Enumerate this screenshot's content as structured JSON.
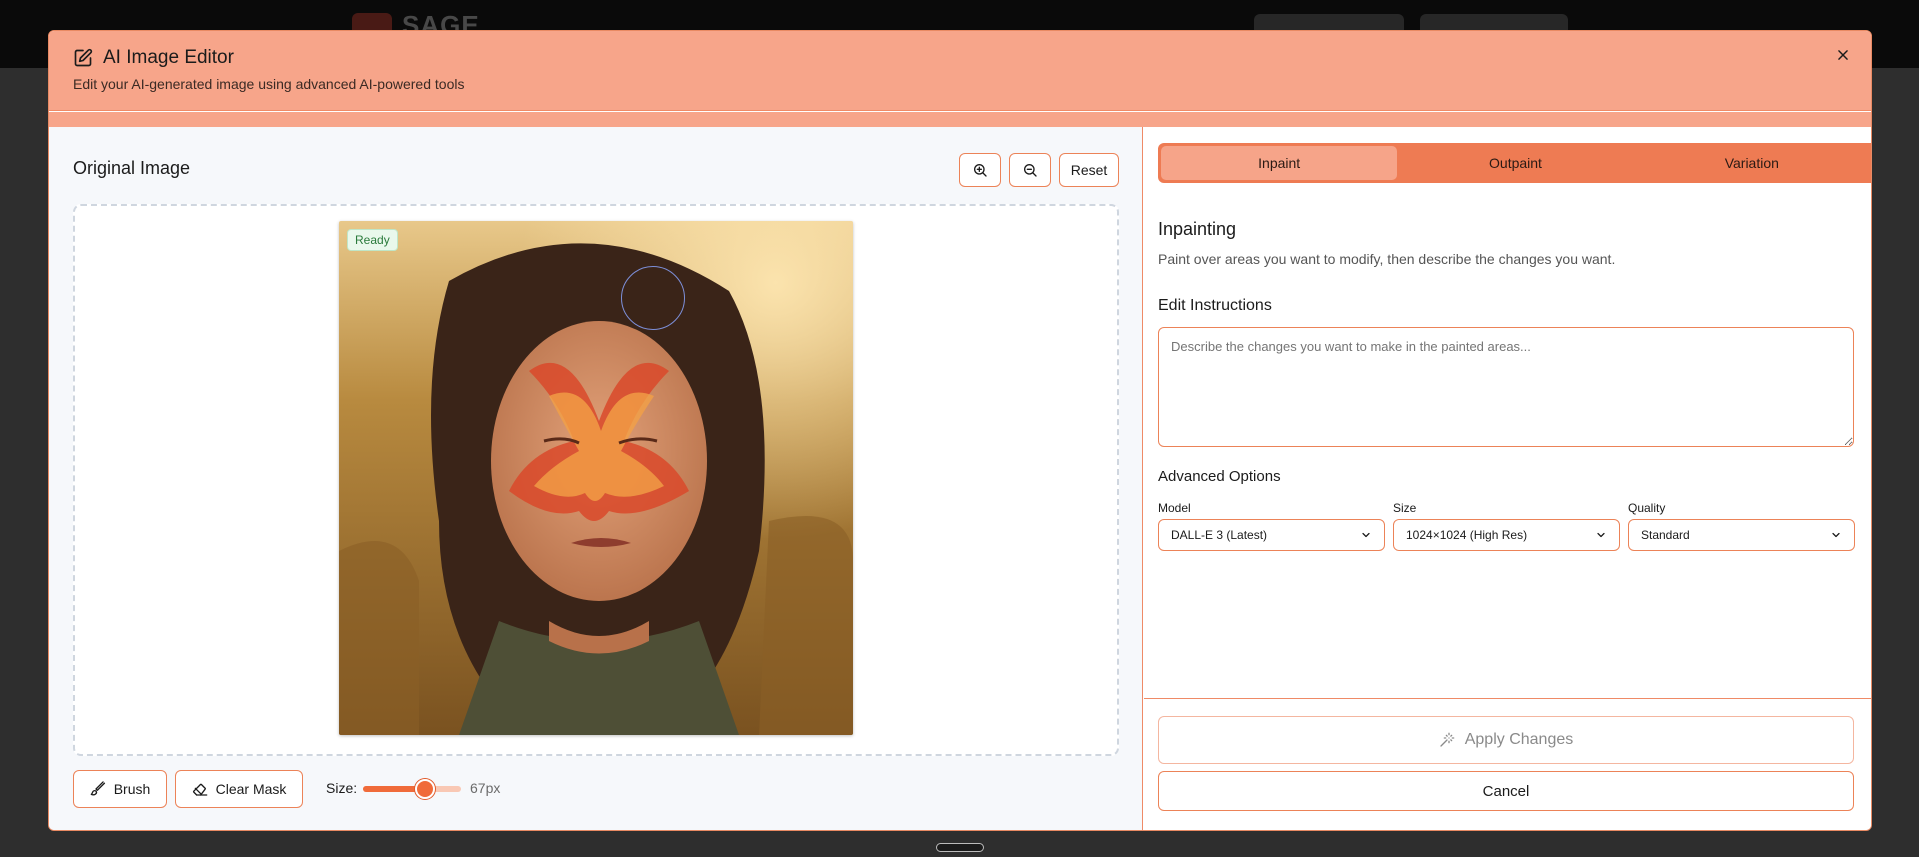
{
  "background_app": {
    "logo_text": "SAGE"
  },
  "modal": {
    "title": "AI Image Editor",
    "subtitle": "Edit your AI-generated image using advanced AI-powered tools",
    "close_icon": "close-icon",
    "accent_color": "#f7a58a"
  },
  "left_pane": {
    "title": "Original Image",
    "zoom_in_icon": "zoom-in-icon",
    "zoom_out_icon": "zoom-out-icon",
    "reset_label": "Reset",
    "status_badge": "Ready",
    "brush_label": "Brush",
    "clear_mask_label": "Clear Mask",
    "size_label": "Size:",
    "size_value": "67px",
    "brush_size_fraction": 0.63
  },
  "right_pane": {
    "tabs": [
      {
        "label": "Inpaint",
        "active": true
      },
      {
        "label": "Outpaint",
        "active": false
      },
      {
        "label": "Variation",
        "active": false
      }
    ],
    "section_title": "Inpainting",
    "section_desc": "Paint over areas you want to modify, then describe the changes you want.",
    "edit_label": "Edit Instructions",
    "edit_placeholder": "Describe the changes you want to make in the painted areas...",
    "advanced_label": "Advanced Options",
    "options": {
      "model": {
        "label": "Model",
        "value": "DALL-E 3 (Latest)"
      },
      "size": {
        "label": "Size",
        "value": "1024×1024 (High Res)"
      },
      "quality": {
        "label": "Quality",
        "value": "Standard"
      }
    },
    "apply_label": "Apply Changes",
    "cancel_label": "Cancel"
  }
}
